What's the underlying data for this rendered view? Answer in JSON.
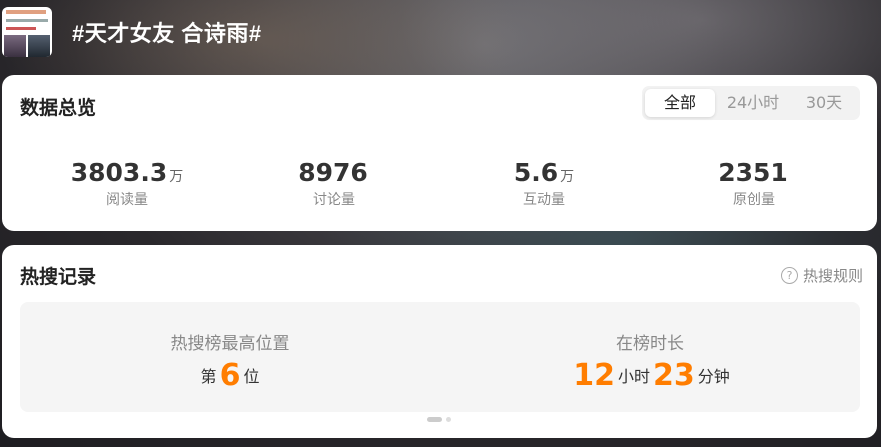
{
  "header": {
    "title": "#天才女友 合诗雨#"
  },
  "overview": {
    "title": "数据总览",
    "tabs": [
      {
        "label": "全部",
        "active": true
      },
      {
        "label": "24小时",
        "active": false
      },
      {
        "label": "30天",
        "active": false
      }
    ],
    "stats": [
      {
        "value": "3803.3",
        "unit": "万",
        "label": "阅读量"
      },
      {
        "value": "8976",
        "unit": "",
        "label": "讨论量"
      },
      {
        "value": "5.6",
        "unit": "万",
        "label": "互动量"
      },
      {
        "value": "2351",
        "unit": "",
        "label": "原创量"
      }
    ]
  },
  "hot": {
    "title": "热搜记录",
    "rules_label": "热搜规则",
    "rules_icon": "question-circle-icon",
    "highest": {
      "label": "热搜榜最高位置",
      "prefix": "第",
      "value": "6",
      "suffix": "位"
    },
    "duration": {
      "label": "在榜时长",
      "hours": "12",
      "hours_unit": "小时",
      "minutes": "23",
      "minutes_unit": "分钟"
    }
  },
  "colors": {
    "accent": "#ff7d00"
  }
}
